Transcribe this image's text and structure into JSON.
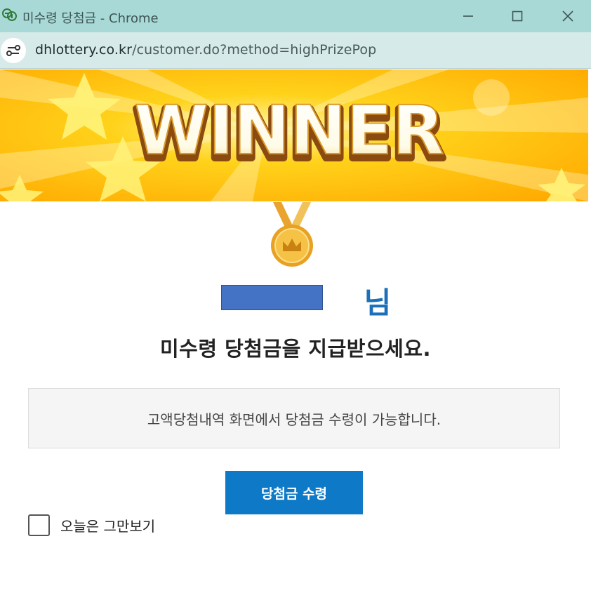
{
  "window": {
    "title": "미수령 당첨금 - Chrome",
    "app_icon": "dhlottery-clover-icon",
    "controls": [
      "minimize-icon",
      "maximize-icon",
      "close-icon"
    ]
  },
  "address_bar": {
    "host": "dhlottery.co.kr",
    "path": "/customer.do?method=highPrizePop"
  },
  "banner": {
    "text": "WINNER"
  },
  "greeting": {
    "name_visible": "님",
    "name_redacted": true
  },
  "headline": "미수령 당첨금을 지급받으세요.",
  "info": "고액당첨내역 화면에서 당첨금 수령이 가능합니다.",
  "claim_button": "당첨금 수령",
  "dismiss_today": {
    "label": "오늘은 그만보기",
    "checked": false
  },
  "colors": {
    "titlebar": "#a9d9d6",
    "addressbar": "#d6ebe9",
    "accent_blue": "#0d79c7",
    "greeting_blue": "#1c6fb9",
    "banner_yellow": "#ffcc00",
    "redaction": "#4472c4"
  }
}
